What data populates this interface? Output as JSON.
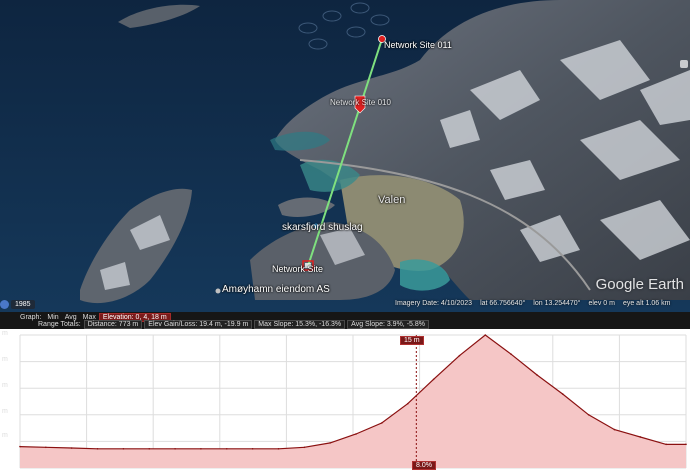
{
  "map": {
    "markers": {
      "network_site_011": "Network Site 011",
      "network_site_upper": "Network Site 010",
      "network_site_lower": "Network Site",
      "skarsfjord": "skarsfjord shuslag",
      "amoyhamn": "Amøyhamn eiendom AS",
      "valen": "Valen"
    },
    "year_badge": "1985",
    "google_logo": "Google Earth",
    "status": {
      "imagery_date": "Imagery Date: 4/10/2023",
      "lat": "lat 66.756640°",
      "lon": "lon 13.254470°",
      "elev": "elev 0 m",
      "eye_alt": "eye alt 1.06 km"
    },
    "colors": {
      "path_line": "#7fe07f",
      "marker_red": "#e02020",
      "water": "#0f2b48"
    }
  },
  "profile": {
    "graph_row": {
      "graph_label": "Graph:",
      "min": "Min",
      "avg": "Avg",
      "max": "Max",
      "elevation": "Elevation: 0, 4, 18 m"
    },
    "range_row": {
      "range_totals": "Range Totals:",
      "distance": "Distance: 773 m",
      "elev_gain_loss": "Elev Gain/Loss: 19.4 m, -19.9 m",
      "max_slope": "Max Slope: 15.3%, -16.3%",
      "avg_slope": "Avg Slope: 3.9%, -5.8%"
    },
    "tip_label": "15 m",
    "bottom_label": "8.0%",
    "y_labels": [
      "m",
      "m",
      "m",
      "m",
      "m"
    ],
    "fill_color": "#f5c6c6",
    "line_color": "#8a1010"
  },
  "chart_data": {
    "type": "area",
    "x": [
      0,
      30,
      60,
      90,
      120,
      150,
      180,
      210,
      240,
      270,
      300,
      330,
      360,
      390,
      420,
      450,
      480,
      510,
      540,
      570,
      600,
      630,
      660,
      690,
      720,
      750,
      773
    ],
    "values": [
      2.9,
      2.8,
      2.7,
      2.6,
      2.6,
      2.6,
      2.6,
      2.6,
      2.6,
      2.6,
      2.6,
      2.8,
      3.4,
      4.6,
      6.1,
      8.7,
      12.0,
      15.2,
      18.0,
      15.4,
      12.6,
      10.0,
      7.2,
      5.2,
      4.2,
      3.2,
      3.2
    ],
    "ylim": [
      0,
      18
    ]
  }
}
